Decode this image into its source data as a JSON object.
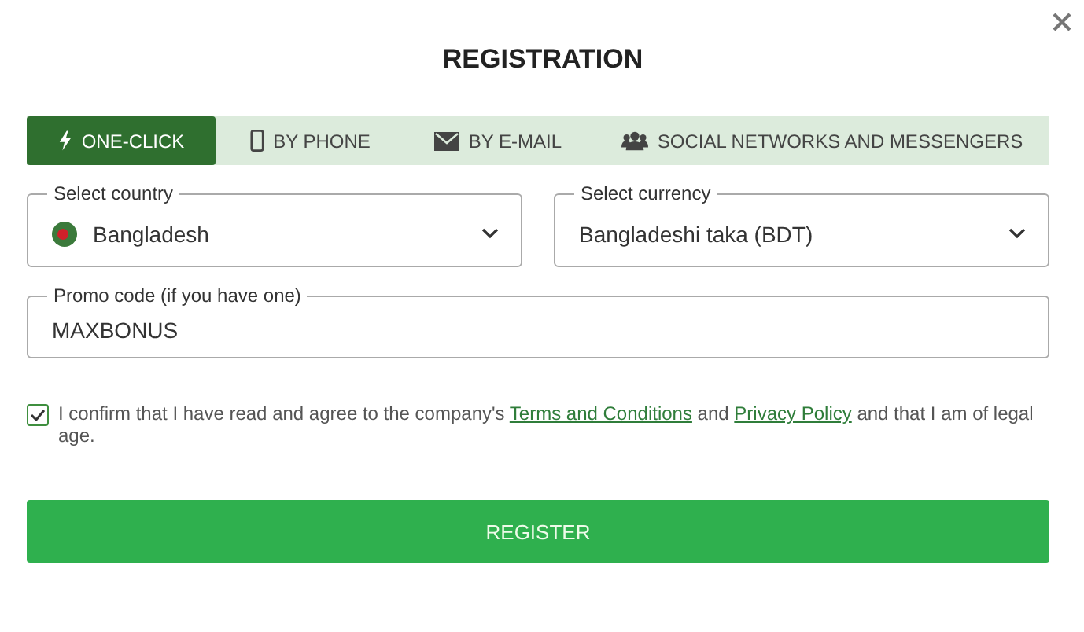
{
  "title": "REGISTRATION",
  "tabs": [
    {
      "label": "ONE-CLICK",
      "selected": true
    },
    {
      "label": "BY PHONE",
      "selected": false
    },
    {
      "label": "BY E-MAIL",
      "selected": false
    },
    {
      "label": "SOCIAL NETWORKS AND MESSENGERS",
      "selected": false
    }
  ],
  "country": {
    "label": "Select country",
    "value": "Bangladesh"
  },
  "currency": {
    "label": "Select currency",
    "value": "Bangladeshi taka (BDT)"
  },
  "promo": {
    "label": "Promo code (if you have one)",
    "value": "MAXBONUS"
  },
  "agreement": {
    "checked": true,
    "parts": [
      {
        "kind": "text",
        "text": "I confirm that I have read and agree to the company's "
      },
      {
        "kind": "link",
        "text": "Terms and Conditions"
      },
      {
        "kind": "text",
        "text": " and "
      },
      {
        "kind": "link",
        "text": "Privacy Policy"
      },
      {
        "kind": "text",
        "text": " and that I am of legal age."
      }
    ]
  },
  "register_button": "REGISTER"
}
